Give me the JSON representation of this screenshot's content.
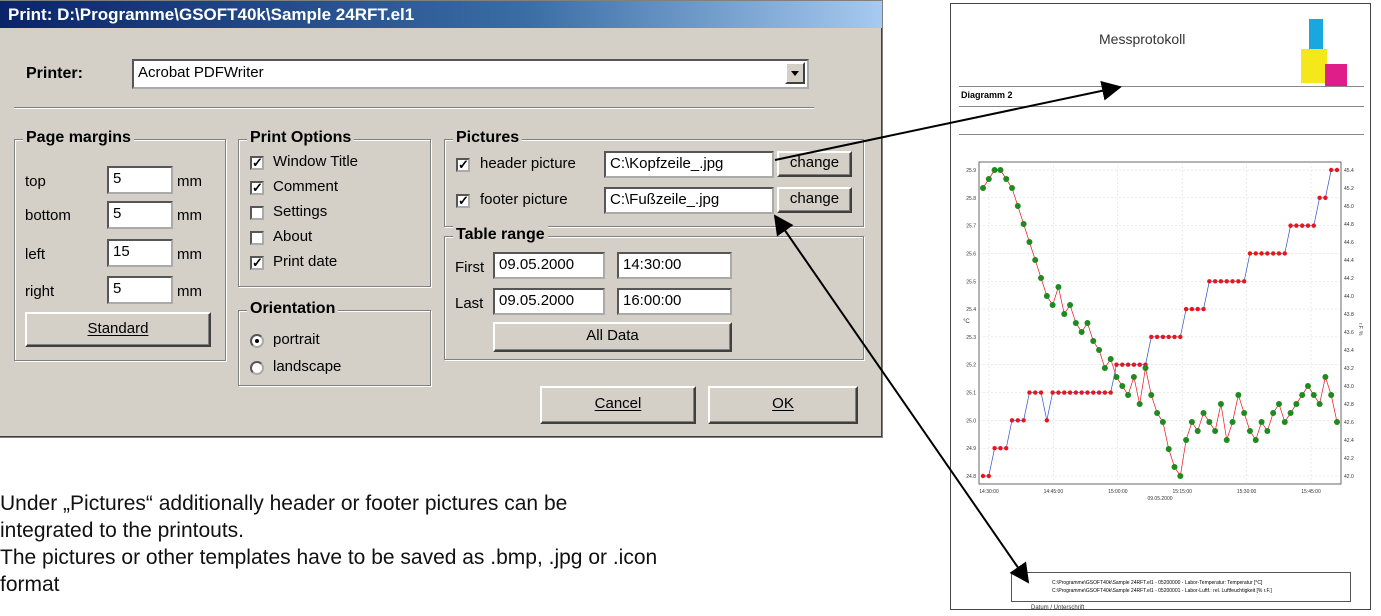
{
  "dialog": {
    "title": "Print: D:\\Programme\\GSOFT40k\\Sample 24RFT.el1",
    "printer_label": "Printer:",
    "printer_value": "Acrobat PDFWriter",
    "margins": {
      "title": "Page margins",
      "rows": [
        {
          "label": "top",
          "value": "5",
          "unit": "mm"
        },
        {
          "label": "bottom",
          "value": "5",
          "unit": "mm"
        },
        {
          "label": "left",
          "value": "15",
          "unit": "mm"
        },
        {
          "label": "right",
          "value": "5",
          "unit": "mm"
        }
      ],
      "standard_button": "Standard"
    },
    "print_options": {
      "title": "Print Options",
      "items": [
        {
          "label": "Window Title",
          "checked": true
        },
        {
          "label": "Comment",
          "checked": true
        },
        {
          "label": "Settings",
          "checked": false
        },
        {
          "label": "About",
          "checked": false
        },
        {
          "label": "Print date",
          "checked": true
        }
      ]
    },
    "orientation": {
      "title": "Orientation",
      "options": [
        {
          "label": "portrait",
          "selected": true
        },
        {
          "label": "landscape",
          "selected": false
        }
      ]
    },
    "pictures": {
      "title": "Pictures",
      "header_label": "header picture",
      "header_path": "C:\\Kopfzeile_.jpg",
      "footer_label": "footer picture",
      "footer_path": "C:\\Fußzeile_.jpg",
      "change_label": "change"
    },
    "table_range": {
      "title": "Table range",
      "first_label": "First",
      "first_date": "09.05.2000",
      "first_time": "14:30:00",
      "last_label": "Last",
      "last_date": "09.05.2000",
      "last_time": "16:00:00",
      "all_data_button": "All Data"
    },
    "cancel_button": "Cancel",
    "ok_button": "OK"
  },
  "caption": {
    "line1": "Under „Pictures“ additionally header or footer pictures can be",
    "line2": "integrated to the printouts.",
    "line3": "The pictures or other templates have to be saved as .bmp, .jpg or .icon",
    "line4": "format"
  },
  "printout": {
    "title": "Messprotokoll",
    "diagram_label": "Diagramm 2",
    "signature_label": "Datum / Unterschrift",
    "y_left_label": "°C",
    "y_right_label": "r.F. %",
    "x_date": "09.05.2000",
    "legend_lines": [
      "C:\\Programme\\GSOFT40k\\Sample 24RFT.el1 - 05200000 - Labor-Temperatur: Temperatur [°C]",
      "C:\\Programme\\GSOFT40k\\Sample 24RFT.el1 - 05200001 - Labor-Luftf.: rel. Luftfeuchtigkeit [% r.F.]"
    ],
    "colors": {
      "temperature": "#e8141e",
      "humidity": "#1f8a1f",
      "line_blue": "#3050c8",
      "logo_cyan": "#19a7e0",
      "logo_yellow": "#f4e81a",
      "logo_magenta": "#e01e8a"
    }
  },
  "chart_data": {
    "type": "line",
    "x_ticks": [
      "14:30:00",
      "14:45:00",
      "15:00:00",
      "15:15:00",
      "15:30:00",
      "15:45:00"
    ],
    "y_left_ticks": [
      "25.9",
      "25.8",
      "25.7",
      "25.6",
      "25.5",
      "25.4",
      "25.3",
      "25.2",
      "25.1",
      "25.0",
      "24.9",
      "24.8"
    ],
    "y_right_ticks": [
      "45.4",
      "45.2",
      "45.0",
      "44.8",
      "44.6",
      "44.4",
      "44.2",
      "44.0",
      "43.8",
      "43.6",
      "43.4",
      "43.2",
      "43.0",
      "42.8",
      "42.6",
      "42.4",
      "42.2",
      "42.0"
    ],
    "ylim_left": [
      24.8,
      25.9
    ],
    "ylim_right": [
      42.0,
      45.4
    ],
    "series": [
      {
        "name": "Labor-Temperatur: Temperatur [°C]",
        "axis": "left",
        "values": [
          24.8,
          24.8,
          24.9,
          24.9,
          24.9,
          25.0,
          25.0,
          25.0,
          25.1,
          25.1,
          25.1,
          25.0,
          25.1,
          25.1,
          25.1,
          25.1,
          25.1,
          25.1,
          25.1,
          25.1,
          25.1,
          25.1,
          25.1,
          25.2,
          25.2,
          25.2,
          25.2,
          25.2,
          25.2,
          25.3,
          25.3,
          25.3,
          25.3,
          25.3,
          25.3,
          25.4,
          25.4,
          25.4,
          25.4,
          25.5,
          25.5,
          25.5,
          25.5,
          25.5,
          25.5,
          25.5,
          25.6,
          25.6,
          25.6,
          25.6,
          25.6,
          25.6,
          25.6,
          25.7,
          25.7,
          25.7,
          25.7,
          25.7,
          25.8,
          25.8,
          25.9,
          25.9
        ]
      },
      {
        "name": "Labor-Luftf.: rel. Luftfeuchtigkeit [% r.F.]",
        "axis": "right",
        "values": [
          45.2,
          45.3,
          45.4,
          45.4,
          45.3,
          45.2,
          45.0,
          44.8,
          44.6,
          44.4,
          44.2,
          44.0,
          43.9,
          44.1,
          43.8,
          43.9,
          43.7,
          43.6,
          43.7,
          43.5,
          43.4,
          43.2,
          43.3,
          43.1,
          43.0,
          42.9,
          43.1,
          42.8,
          43.2,
          42.9,
          42.7,
          42.6,
          42.3,
          42.1,
          42.0,
          42.4,
          42.6,
          42.5,
          42.7,
          42.6,
          42.5,
          42.8,
          42.4,
          42.6,
          42.9,
          42.7,
          42.5,
          42.4,
          42.6,
          42.5,
          42.7,
          42.8,
          42.6,
          42.7,
          42.8,
          42.9,
          43.0,
          42.9,
          42.8,
          43.1,
          42.9,
          42.6
        ]
      }
    ]
  }
}
